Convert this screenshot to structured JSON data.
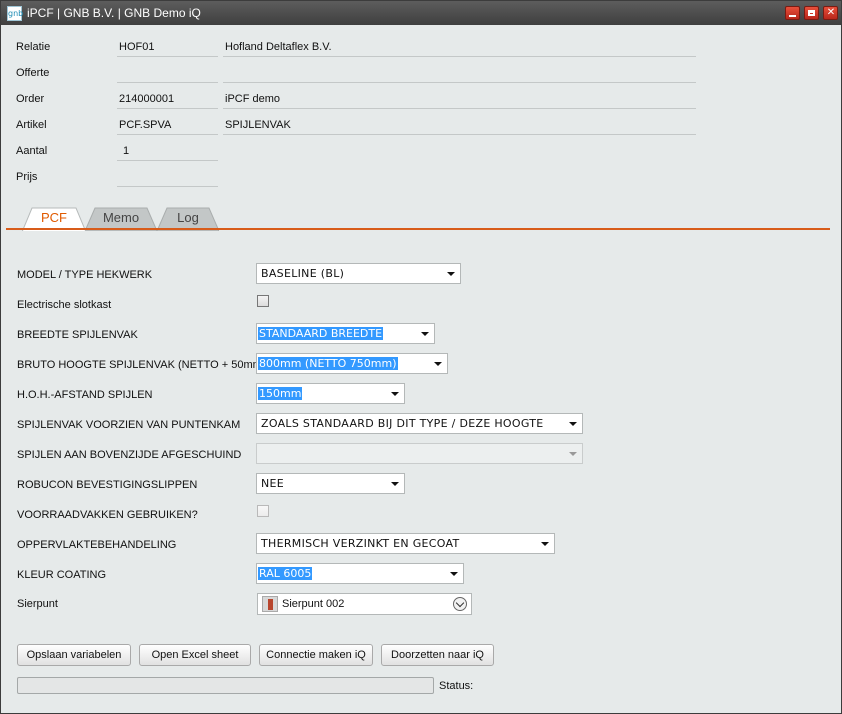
{
  "window": {
    "title": "iPCF | GNB B.V. | GNB Demo iQ",
    "logo_text": "gnb",
    "icons": {
      "minimize": "minimize-icon",
      "maximize": "maximize-icon",
      "close": "close-icon"
    }
  },
  "header": {
    "relatie": {
      "label": "Relatie",
      "code": "HOF01",
      "desc": "Hofland Deltaflex B.V."
    },
    "offerte": {
      "label": "Offerte",
      "code": "",
      "desc": ""
    },
    "order": {
      "label": "Order",
      "code": "214000001",
      "desc": "iPCF demo"
    },
    "artikel": {
      "label": "Artikel",
      "code": "PCF.SPVA",
      "desc": "SPIJLENVAK"
    },
    "aantal": {
      "label": "Aantal",
      "code": "1"
    },
    "prijs": {
      "label": "Prijs",
      "code": ""
    }
  },
  "tabs": [
    {
      "label": "PCF",
      "active": true
    },
    {
      "label": "Memo",
      "active": false
    },
    {
      "label": "Log",
      "active": false
    }
  ],
  "accent_color": "#d85c1a",
  "form": {
    "model": {
      "label": "MODEL / TYPE HEKWERK",
      "value": "BASELINE (BL)"
    },
    "slotkast": {
      "label": "Electrische slotkast",
      "checked": false
    },
    "breedte": {
      "label": "BREEDTE SPIJLENVAK",
      "value": "STANDAARD BREEDTE"
    },
    "hoogte": {
      "label": "BRUTO HOOGTE SPIJLENVAK (NETTO + 50mm)",
      "value": "800mm (NETTO 750mm)"
    },
    "hoh": {
      "label": "H.O.H.-AFSTAND SPIJLEN",
      "value": "150mm"
    },
    "puntenkam": {
      "label": "SPIJLENVAK VOORZIEN VAN PUNTENKAM",
      "value": "ZOALS STANDAARD BIJ DIT TYPE / DEZE HOOGTE"
    },
    "afgeschuind": {
      "label": "SPIJLEN AAN BOVENZIJDE AFGESCHUIND",
      "value": ""
    },
    "robucon": {
      "label": "ROBUCON BEVESTIGINGSLIPPEN",
      "value": "NEE"
    },
    "voorraad": {
      "label": "VOORRAADVAKKEN GEBRUIKEN?",
      "checked": false
    },
    "opp": {
      "label": "OPPERVLAKTEBEHANDELING",
      "value": "THERMISCH VERZINKT EN GECOAT"
    },
    "kleur": {
      "label": "KLEUR COATING",
      "value": "RAL 6005"
    },
    "sierpunt": {
      "label": "Sierpunt",
      "value": "Sierpunt 002"
    }
  },
  "buttons": {
    "opslaan": "Opslaan variabelen",
    "excel": "Open Excel sheet",
    "connectie": "Connectie maken iQ",
    "doorzetten": "Doorzetten naar iQ"
  },
  "status": {
    "label": "Status:",
    "progress": 0
  }
}
